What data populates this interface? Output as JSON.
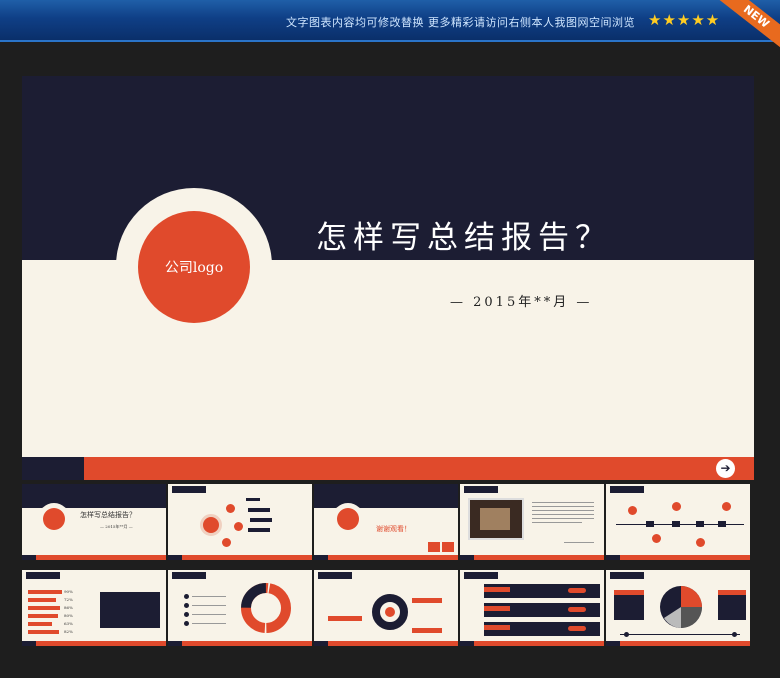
{
  "banner": {
    "text": "文字图表内容均可修改替换   更多精彩请访问右侧本人我图网空间浏览",
    "stars": "★★★★★",
    "new_label": "NEW"
  },
  "main_slide": {
    "logo_text": "公司logo",
    "title": "怎样写总结报告？",
    "date": "— 2015年**月 —",
    "next_icon": "➔"
  },
  "thumbnails": {
    "t1": {
      "title": "怎样写总结报告？",
      "date": "— 2015年**月 —"
    },
    "t3": {
      "thanks": "谢谢观看！"
    },
    "t6_percents": [
      "90%",
      "72%",
      "86%",
      "80%",
      "63%",
      "82%"
    ]
  },
  "colors": {
    "navy": "#1c1d33",
    "accent_red": "#e04a2c",
    "cream": "#f8f3e8",
    "banner_blue": "#0f3f86"
  }
}
